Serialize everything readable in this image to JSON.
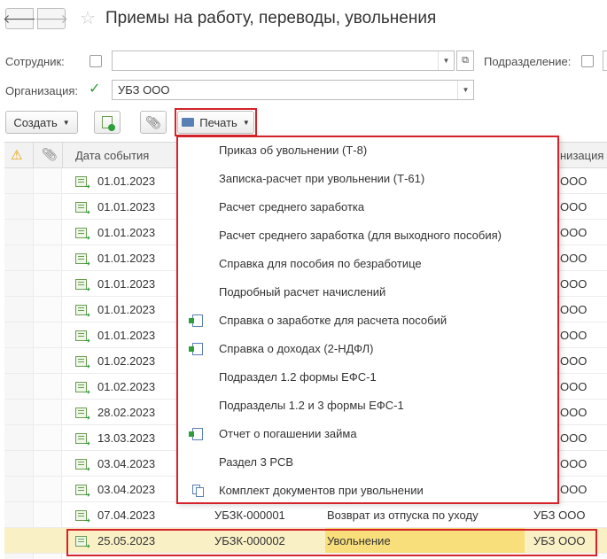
{
  "window": {
    "title": "Приемы на работу, переводы, увольнения",
    "back_glyph": "🡐",
    "forward_glyph": "🡒",
    "star_glyph": "☆"
  },
  "filters": {
    "employee_label": "Сотрудник:",
    "employee_value": "",
    "department_label": "Подразделение:",
    "organization_label": "Организация:",
    "organization_value": "УБЗ ООО"
  },
  "toolbar": {
    "create_label": "Создать",
    "print_label": "Печать"
  },
  "table": {
    "headers": {
      "date": "Дата события",
      "organization_partial": "низация"
    },
    "rows": [
      {
        "date": "01.01.2023",
        "org": "ООО"
      },
      {
        "date": "01.01.2023",
        "org": "ООО"
      },
      {
        "date": "01.01.2023",
        "org": "ООО"
      },
      {
        "date": "01.01.2023",
        "org": "ООО"
      },
      {
        "date": "01.01.2023",
        "org": "ООО"
      },
      {
        "date": "01.01.2023",
        "org": "ООО"
      },
      {
        "date": "01.01.2023",
        "org": "ООО"
      },
      {
        "date": "01.02.2023",
        "org": "ООО"
      },
      {
        "date": "01.02.2023",
        "org": "ООО"
      },
      {
        "date": "28.02.2023",
        "org": "ООО"
      },
      {
        "date": "13.03.2023",
        "org": "ООО"
      },
      {
        "date": "03.04.2023",
        "org": "ООО"
      },
      {
        "date": "03.04.2023",
        "org": "ООО"
      },
      {
        "date": "07.04.2023",
        "number": "УБЗК-000001",
        "event": "Возврат из отпуска по уходу",
        "org": "УБЗ ООО"
      },
      {
        "date": "25.05.2023",
        "number": "УБЗК-000002",
        "event": "Увольнение",
        "org": "УБЗ ООО"
      }
    ]
  },
  "print_menu": {
    "items": [
      {
        "label": "Приказ об увольнении (Т-8)",
        "icon": ""
      },
      {
        "label": "Записка-расчет при увольнении (Т-61)",
        "icon": ""
      },
      {
        "label": "Расчет среднего заработка",
        "icon": ""
      },
      {
        "label": "Расчет среднего заработка (для выходного пособия)",
        "icon": ""
      },
      {
        "label": "Справка для пособия по безработице",
        "icon": ""
      },
      {
        "label": "Подробный расчет начислений",
        "icon": ""
      },
      {
        "label": "Справка о заработке для расчета пособий",
        "icon": "export-icon"
      },
      {
        "label": "Справка о доходах (2-НДФЛ)",
        "icon": "export-icon"
      },
      {
        "label": "Подраздел 1.2 формы ЕФС-1",
        "icon": ""
      },
      {
        "label": "Подразделы 1.2 и 3 формы ЕФС-1",
        "icon": ""
      },
      {
        "label": "Отчет о погашении займа",
        "icon": "export-icon"
      },
      {
        "label": "Раздел 3 РСВ",
        "icon": ""
      },
      {
        "label": "Комплект документов при увольнении",
        "icon": "stack-icon"
      }
    ]
  },
  "colors": {
    "highlight_border": "#d4232b",
    "selected_row": "#faf0c6",
    "selected_cell": "#f9df7b",
    "check_green": "#2e9e3a"
  }
}
